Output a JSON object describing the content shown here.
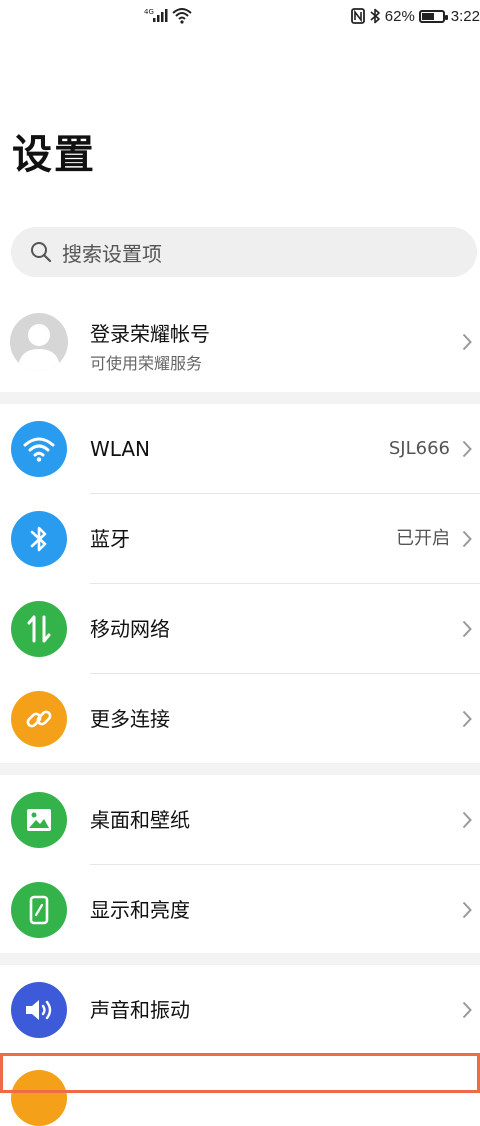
{
  "status_bar": {
    "network": "4G",
    "battery": "62%",
    "battery_level": 0.62,
    "time": "3:22"
  },
  "page_title": "设置",
  "search": {
    "placeholder": "搜索设置项"
  },
  "account": {
    "title": "登录荣耀帐号",
    "subtitle": "可使用荣耀服务"
  },
  "groups": [
    [
      {
        "label": "WLAN",
        "value": "SJL666",
        "icon": "wifi-icon",
        "color": "#2a9cf0"
      },
      {
        "label": "蓝牙",
        "value": "已开启",
        "icon": "bluetooth-icon",
        "color": "#2a9cf0"
      },
      {
        "label": "移动网络",
        "value": "",
        "icon": "mobile-data-icon",
        "color": "#34b34a"
      },
      {
        "label": "更多连接",
        "value": "",
        "icon": "link-icon",
        "color": "#f5a019"
      }
    ],
    [
      {
        "label": "桌面和壁纸",
        "value": "",
        "icon": "wallpaper-icon",
        "color": "#34b34a"
      },
      {
        "label": "显示和亮度",
        "value": "",
        "icon": "display-icon",
        "color": "#34b34a"
      }
    ],
    [
      {
        "label": "声音和振动",
        "value": "",
        "icon": "sound-icon",
        "color": "#3d5ad8"
      }
    ]
  ],
  "colors": {
    "highlight_border": "#ee6b4a",
    "peek_icon": "#f5a019"
  }
}
